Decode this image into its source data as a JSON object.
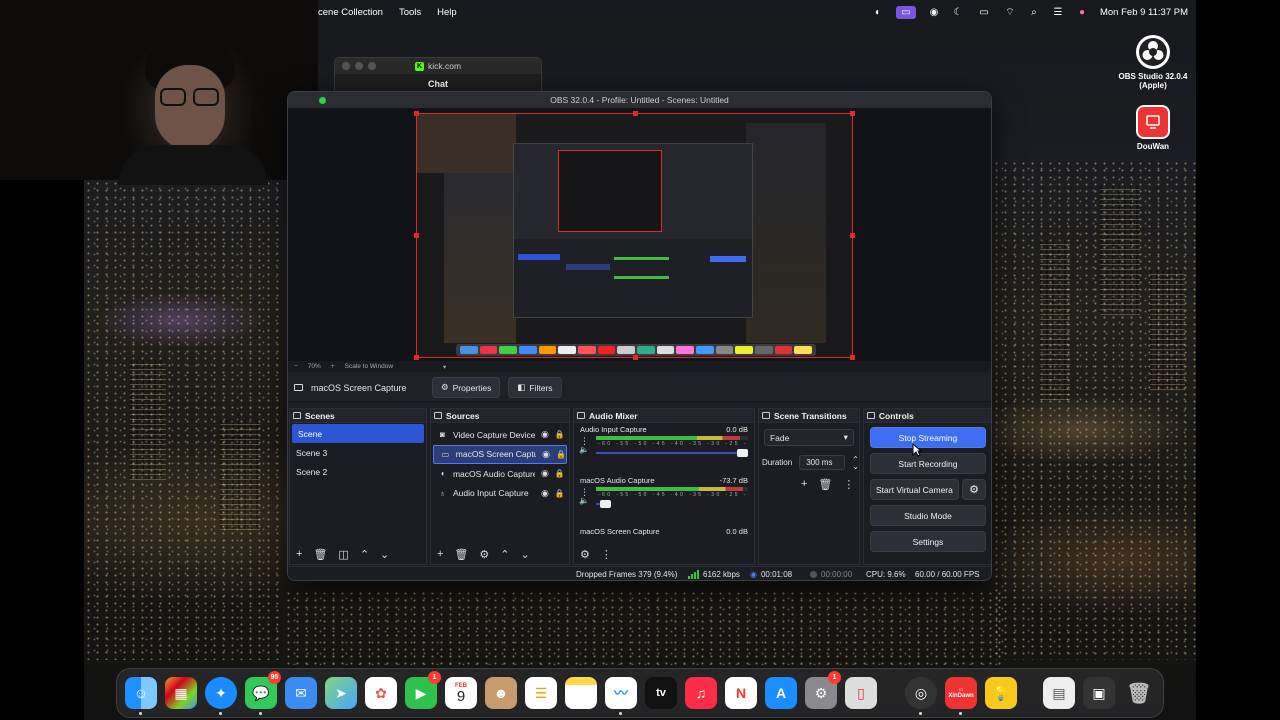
{
  "menubar": {
    "items": [
      "cene Collection",
      "Tools",
      "Help"
    ],
    "clock": "Mon Feb 9  11:37 PM"
  },
  "desktop": {
    "icons": [
      {
        "label": "OBS Studio 32.0.4\n(Apple)"
      },
      {
        "label": "DouWan"
      }
    ]
  },
  "kick_window": {
    "title": "kick.com",
    "chat_label": "Chat"
  },
  "obs": {
    "window_title": "OBS 32.0.4 - Profile: Untitled - Scenes: Untitled",
    "preview_bar": {
      "zoom_minus": "−",
      "zoom": "70%",
      "zoom_plus": "+",
      "scale_label": "Scale to Window"
    },
    "source_toolbar": {
      "selected_source": "macOS Screen Capture",
      "properties_label": "Properties",
      "filters_label": "Filters"
    },
    "scenes": {
      "title": "Scenes",
      "items": [
        "Scene",
        "Scene 3",
        "Scene 2"
      ],
      "active_index": 0
    },
    "sources": {
      "title": "Sources",
      "items": [
        "Video Capture Device",
        "macOS Screen Captur",
        "macOS Audio Capture",
        "Audio Input Capture"
      ],
      "active_index": 1
    },
    "audio_mixer": {
      "title": "Audio Mixer",
      "channels": [
        {
          "name": "Audio Input Capture",
          "db": "0.0 dB",
          "level": 0.95,
          "volume": 1.0
        },
        {
          "name": "macOS Audio Capture",
          "db": "-73.7 dB",
          "level": 0.97,
          "volume": 0.1
        },
        {
          "name": "macOS Screen Capture",
          "db": "0.0 dB",
          "level": 0.0,
          "volume": 1.0
        }
      ],
      "scale": "-60 -55 -50 -45 -40 -35 -30 -25 -20 -15 -10 -5 0"
    },
    "scene_transitions": {
      "title": "Scene Transitions",
      "transition": "Fade",
      "duration_label": "Duration",
      "duration_value": "300 ms"
    },
    "controls": {
      "title": "Controls",
      "stop_streaming": "Stop Streaming",
      "start_recording": "Start Recording",
      "start_virtual_camera": "Start Virtual Camera",
      "studio_mode": "Studio Mode",
      "settings": "Settings"
    },
    "status": {
      "dropped_frames": "Dropped Frames 379 (9.4%)",
      "bitrate": "6162 kbps",
      "stream_time": "00:01:08",
      "record_time": "00:00:00",
      "cpu": "CPU: 9.6%",
      "fps": "60.00 / 60.00 FPS"
    }
  },
  "dock": {
    "badges": {
      "messages": "95",
      "facetime": "1",
      "calendar_month": "FEB",
      "calendar_day": "9",
      "settings": "1"
    },
    "xindawn_label": "XinDawn",
    "tv_label": "tv"
  },
  "colors": {
    "accent": "#3d6df0",
    "selection": "#2c55d6",
    "record_border": "#e02a2a",
    "meter_green": "#3fbf3f"
  }
}
